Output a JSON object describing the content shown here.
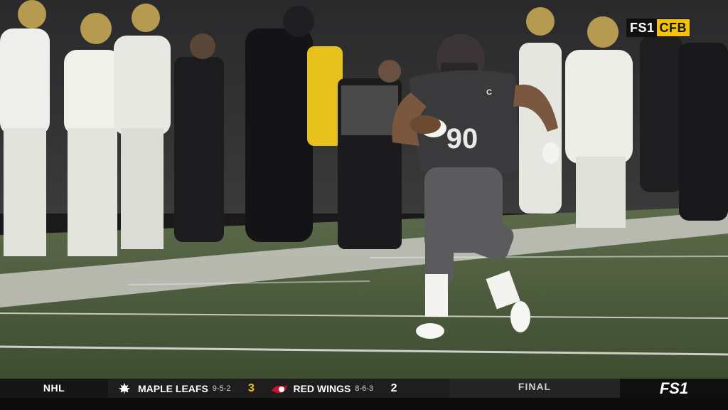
{
  "network_bug": {
    "network": "FS1",
    "sport": "CFB"
  },
  "player": {
    "jersey_number": "90",
    "captain_patch": "C"
  },
  "ticker": {
    "league": "NHL",
    "away": {
      "name": "MAPLE LEAFS",
      "record": "9-5-2",
      "score": "3",
      "logo": "maple-leaf-icon"
    },
    "home": {
      "name": "RED WINGS",
      "record": "8-6-3",
      "score": "2",
      "logo": "winged-wheel-icon"
    },
    "status": "FINAL",
    "network": "FS1"
  },
  "colors": {
    "bug_yellow": "#f5c400",
    "turf": "#4a5a3a",
    "player_jersey": "#3a3a3c",
    "ticker_bg": "#0f0f10"
  }
}
